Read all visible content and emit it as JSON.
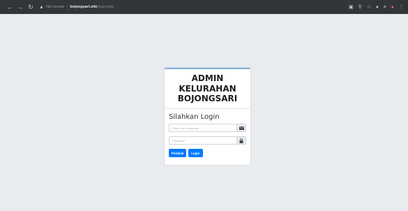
{
  "browser": {
    "security_label": "Not secure",
    "url_host": "bojongsari.site",
    "url_path": "/login.php",
    "icons": [
      "back-icon",
      "forward-icon",
      "reload-icon",
      "warning-icon",
      "translate-icon",
      "zoom-icon",
      "star-icon",
      "extension-icon",
      "reading-list-icon",
      "profile-icon",
      "menu-icon"
    ]
  },
  "card": {
    "title_line1": "ADMIN",
    "title_line2": "KELURAHAN",
    "title_line3": "BOJONGSARI",
    "subtitle": "Silahkan Login",
    "username_placeholder": "Entry Your Username",
    "password_placeholder": "Password",
    "reset_label": "Pembali",
    "login_label": "Login"
  },
  "colors": {
    "background": "#e9ecef",
    "chrome": "#323639",
    "primary": "#007bff",
    "card_accent": "#7aaede"
  }
}
